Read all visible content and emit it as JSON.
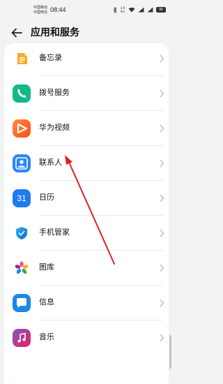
{
  "status": {
    "carrier_1": "中国移动",
    "carrier_2": "中国电信",
    "time": "08:44",
    "net_speed_value": "3.9",
    "net_speed_unit": "K/s",
    "battery": "96"
  },
  "header": {
    "title": "应用和服务"
  },
  "apps": [
    {
      "label": "备忘录",
      "icon": "memo-icon"
    },
    {
      "label": "拨号服务",
      "icon": "phone-icon"
    },
    {
      "label": "华为视频",
      "icon": "video-icon"
    },
    {
      "label": "联系人",
      "icon": "contacts-icon"
    },
    {
      "label": "日历",
      "icon": "calendar-icon",
      "icon_text": "31"
    },
    {
      "label": "手机管家",
      "icon": "shield-icon"
    },
    {
      "label": "图库",
      "icon": "gallery-icon"
    },
    {
      "label": "信息",
      "icon": "messages-icon"
    },
    {
      "label": "音乐",
      "icon": "music-icon"
    }
  ],
  "colors": {
    "background": "#f1f3f5",
    "card": "#ffffff",
    "annotation_arrow": "#e02020",
    "calendar": "#1e7bf0",
    "phone": "#12b888",
    "video": "#ff6a1a",
    "contacts": "#2f86f6"
  }
}
